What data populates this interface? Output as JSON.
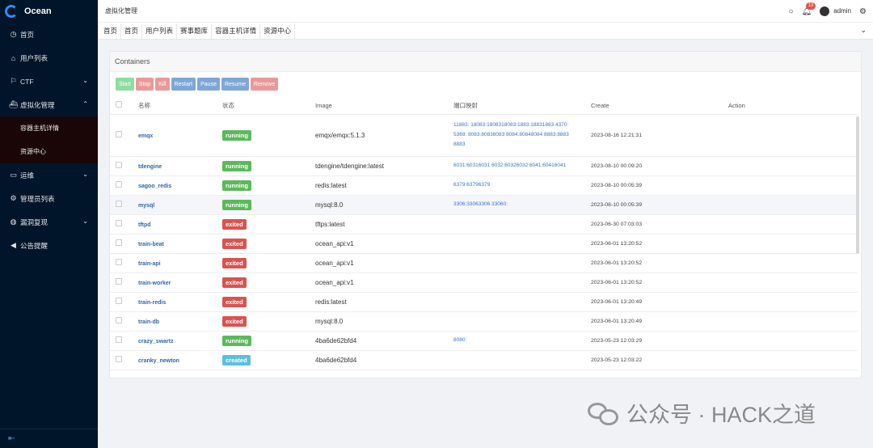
{
  "app": {
    "name": "Ocean"
  },
  "sidebar": {
    "items": [
      {
        "label": "首页",
        "icon": "dashboard-icon",
        "glyph": "◷"
      },
      {
        "label": "用户列表",
        "icon": "home-icon",
        "glyph": "⌂"
      },
      {
        "label": "CTF",
        "icon": "flag-icon",
        "glyph": "⚐",
        "caret": "⌄"
      },
      {
        "label": "虚拟化管理",
        "icon": "ship-icon",
        "glyph": "⛴",
        "caret": "⌃"
      }
    ],
    "subitems": [
      {
        "label": "容器主机详情"
      },
      {
        "label": "资源中心"
      }
    ],
    "items2": [
      {
        "label": "运维",
        "icon": "monitor-icon",
        "glyph": "▭",
        "caret": "⌄"
      },
      {
        "label": "管理员列表",
        "icon": "gear-icon",
        "glyph": "⚙"
      },
      {
        "label": "漏洞复现",
        "icon": "globe-icon",
        "glyph": "◍",
        "caret": "⌄"
      },
      {
        "label": "公告提醒",
        "icon": "megaphone-icon",
        "glyph": "◀"
      }
    ],
    "collapse_glyph": "⇤"
  },
  "topbar": {
    "title": "虚拟化管理",
    "notifications": "13",
    "user": "admin"
  },
  "tabs": [
    {
      "label": "首页"
    },
    {
      "label": "首页"
    },
    {
      "label": "用户列表"
    },
    {
      "label": "赛事题库"
    },
    {
      "label": "容器主机详情"
    },
    {
      "label": "资源中心"
    }
  ],
  "card": {
    "title": "Containers"
  },
  "actions": [
    {
      "label": "Start",
      "color": "#8fdca0"
    },
    {
      "label": "Stop",
      "color": "#e79a9a"
    },
    {
      "label": "Kill",
      "color": "#e79a9a"
    },
    {
      "label": "Restart",
      "color": "#7fa7d6"
    },
    {
      "label": "Pause",
      "color": "#7fa7d6"
    },
    {
      "label": "Resume",
      "color": "#7fa7d6"
    },
    {
      "label": "Remove",
      "color": "#e79a9a"
    }
  ],
  "columns": {
    "name": "名称",
    "status": "状态",
    "image": "Image",
    "ports": "端口映射",
    "create": "Create",
    "action": "Action"
  },
  "status_colors": {
    "running": "#5cb85c",
    "exited": "#d9534f",
    "created": "#5bc0de"
  },
  "containers": [
    {
      "name": "emqx",
      "status": "running",
      "image": "emqx/emqx:5.1.3",
      "ports": "11883: 18083:1808318083:1883:18831883 4370:\n5369: 8083:80838083 8084:80848084 8883:8883\n8883",
      "create": "2023-08-16 12:21:31"
    },
    {
      "name": "tdengine",
      "status": "running",
      "image": "tdengine/tdengine:latest",
      "ports": "6031:60316031 6032:60326032 6041:60416041",
      "create": "2023-08-10 00:09:20"
    },
    {
      "name": "sagoo_redis",
      "status": "running",
      "image": "redis:latest",
      "ports": "6379:63796379",
      "create": "2023-08-10 00:05:39"
    },
    {
      "name": "mysql",
      "status": "running",
      "image": "mysql:8.0",
      "ports": "3306:33063306 33060:",
      "create": "2023-08-10 00:05:39"
    },
    {
      "name": "tftpd",
      "status": "exited",
      "image": "tftps:latest",
      "ports": "",
      "create": "2023-06-30 07:03:03"
    },
    {
      "name": "train-beat",
      "status": "exited",
      "image": "ocean_api:v1",
      "ports": "",
      "create": "2023-06-01 13:20:52"
    },
    {
      "name": "train-api",
      "status": "exited",
      "image": "ocean_api:v1",
      "ports": "",
      "create": "2023-06-01 13:20:52"
    },
    {
      "name": "train-worker",
      "status": "exited",
      "image": "ocean_api:v1",
      "ports": "",
      "create": "2023-06-01 13:20:52"
    },
    {
      "name": "train-redis",
      "status": "exited",
      "image": "redis:latest",
      "ports": "",
      "create": "2023-06-01 13:20:49"
    },
    {
      "name": "train-db",
      "status": "exited",
      "image": "mysql:8.0",
      "ports": "",
      "create": "2023-06-01 13:20:49"
    },
    {
      "name": "crazy_swartz",
      "status": "running",
      "image": "4ba6de62bfd4",
      "ports": "8080:",
      "create": "2023-05-23 12:03:29"
    },
    {
      "name": "cranky_newton",
      "status": "created",
      "image": "4ba6de62bfd4",
      "ports": "",
      "create": "2023-05-23 12:03:22"
    }
  ],
  "watermark": {
    "text": "公众号 · HACK之道"
  }
}
